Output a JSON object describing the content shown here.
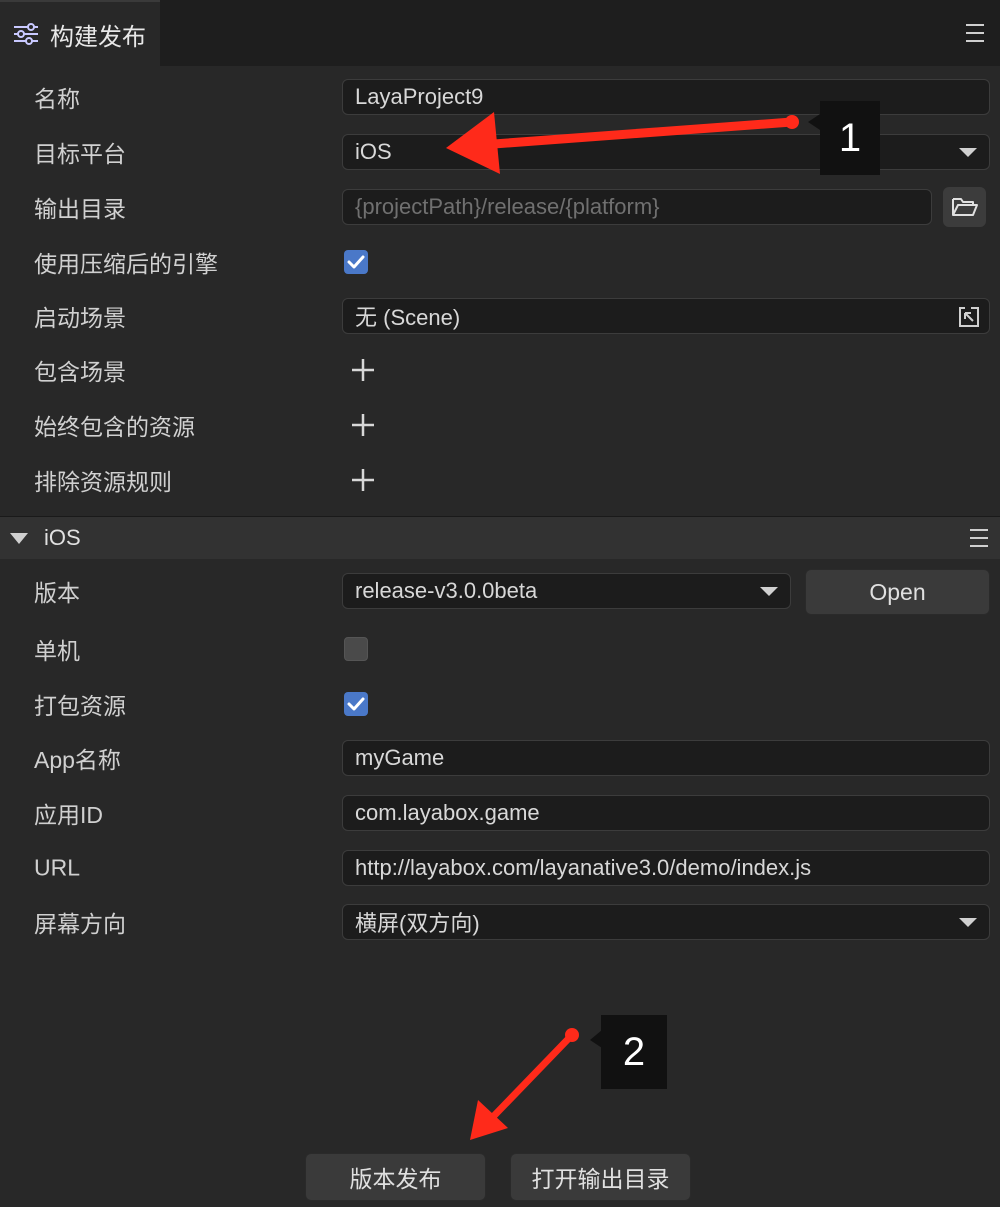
{
  "window": {
    "tab_title": "构建发布"
  },
  "general": {
    "name": {
      "label": "名称",
      "value": "LayaProject9"
    },
    "platform": {
      "label": "目标平台",
      "value": "iOS"
    },
    "output_dir": {
      "label": "输出目录",
      "placeholder": "{projectPath}/release/{platform}"
    },
    "compressed_engine": {
      "label": "使用压缩后的引擎",
      "checked": true
    },
    "start_scene": {
      "label": "启动场景",
      "value": "无 (Scene)"
    },
    "include_scenes": {
      "label": "包含场景"
    },
    "always_include": {
      "label": "始终包含的资源"
    },
    "exclude_rules": {
      "label": "排除资源规则"
    }
  },
  "ios": {
    "section_title": "iOS",
    "version": {
      "label": "版本",
      "value": "release-v3.0.0beta",
      "open_label": "Open"
    },
    "standalone": {
      "label": "单机",
      "checked": false
    },
    "pack_resources": {
      "label": "打包资源",
      "checked": true
    },
    "app_name": {
      "label": "App名称",
      "value": "myGame"
    },
    "app_id": {
      "label": "应用ID",
      "value": "com.layabox.game"
    },
    "url": {
      "label": "URL",
      "value": "http://layabox.com/layanative3.0/demo/index.js"
    },
    "orientation": {
      "label": "屏幕方向",
      "value": "横屏(双方向)"
    }
  },
  "footer": {
    "publish_label": "版本发布",
    "open_output_label": "打开输出目录"
  },
  "annotations": {
    "badge1": "1",
    "badge2": "2",
    "arrow_color": "#ff2a1a"
  },
  "colors": {
    "accent": "#4a78c8",
    "background": "#282828"
  }
}
